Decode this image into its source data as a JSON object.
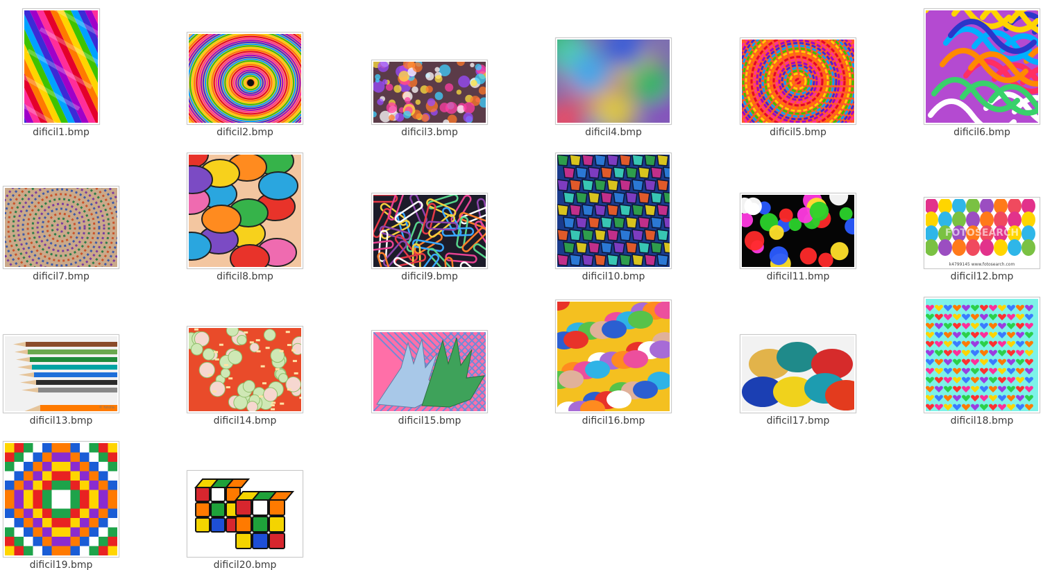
{
  "files": [
    {
      "name": "dificil1.bmp",
      "icon": "image-thumbnail-rainbow-stripes"
    },
    {
      "name": "dificil2.bmp",
      "icon": "image-thumbnail-rainbow-tunnel"
    },
    {
      "name": "dificil3.bmp",
      "icon": "image-thumbnail-color-powder-crowd"
    },
    {
      "name": "dificil4.bmp",
      "icon": "image-thumbnail-blurred-colors"
    },
    {
      "name": "dificil5.bmp",
      "icon": "image-thumbnail-psychedelic-spiral"
    },
    {
      "name": "dificil6.bmp",
      "icon": "image-thumbnail-paint-swirls"
    },
    {
      "name": "dificil7.bmp",
      "icon": "image-thumbnail-mandala"
    },
    {
      "name": "dificil8.bmp",
      "icon": "image-thumbnail-abstract-art"
    },
    {
      "name": "dificil9.bmp",
      "icon": "image-thumbnail-paper-clips"
    },
    {
      "name": "dificil10.bmp",
      "icon": "image-thumbnail-stained-glass"
    },
    {
      "name": "dificil11.bmp",
      "icon": "image-thumbnail-bokeh-lights"
    },
    {
      "name": "dificil12.bmp",
      "icon": "image-thumbnail-balloons"
    },
    {
      "name": "dificil13.bmp",
      "icon": "image-thumbnail-colored-pencils"
    },
    {
      "name": "dificil14.bmp",
      "icon": "image-thumbnail-salad"
    },
    {
      "name": "dificil15.bmp",
      "icon": "image-thumbnail-painted-hands"
    },
    {
      "name": "dificil16.bmp",
      "icon": "image-thumbnail-colored-blobs"
    },
    {
      "name": "dificil17.bmp",
      "icon": "image-thumbnail-pigment-piles"
    },
    {
      "name": "dificil18.bmp",
      "icon": "image-thumbnail-hearts-pattern"
    },
    {
      "name": "dificil19.bmp",
      "icon": "image-thumbnail-pixel-diamond"
    },
    {
      "name": "dificil20.bmp",
      "icon": "image-thumbnail-rubiks-cubes"
    }
  ],
  "overlay_text": {
    "balloons_watermark": "FOTOSEARCH",
    "balloons_footer": "k4799145 www.fotosearch.com",
    "pencils_credit": "© fotolia"
  },
  "palette": {
    "label_text": "#3c3c3c",
    "frame_border": "#c9c9c9",
    "background": "#ffffff"
  }
}
